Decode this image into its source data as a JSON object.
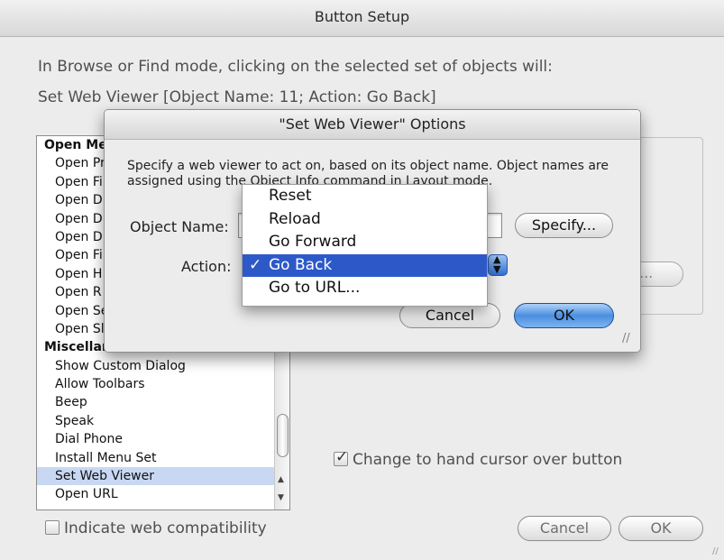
{
  "window": {
    "title": "Button Setup",
    "intro": "In Browse or Find mode, clicking on the selected set of objects will:",
    "step_description": "Set Web Viewer [Object Name: 11; Action: Go Back]"
  },
  "step_list": {
    "rows": [
      {
        "label": "Open Me",
        "category": true
      },
      {
        "label": "Open Pr"
      },
      {
        "label": "Open Fi"
      },
      {
        "label": "Open D"
      },
      {
        "label": "Open D"
      },
      {
        "label": "Open D"
      },
      {
        "label": "Open Fi"
      },
      {
        "label": "Open H"
      },
      {
        "label": "Open R"
      },
      {
        "label": "Open Se"
      },
      {
        "label": "Open Sl"
      },
      {
        "label": "Miscellaneous",
        "category": true
      },
      {
        "label": "Show Custom Dialog"
      },
      {
        "label": "Allow Toolbars"
      },
      {
        "label": "Beep"
      },
      {
        "label": "Speak"
      },
      {
        "label": "Dial Phone"
      },
      {
        "label": "Install Menu Set"
      },
      {
        "label": "Set Web Viewer",
        "selected": true
      },
      {
        "label": "Open URL"
      }
    ]
  },
  "options_partial_label": "...",
  "hand_cursor": {
    "label": "Change to hand cursor over button",
    "checked": true,
    "mark": "✓"
  },
  "web_compat": {
    "label": "Indicate web compatibility",
    "checked": false
  },
  "buttons": {
    "cancel": "Cancel",
    "ok": "OK"
  },
  "options_dialog": {
    "title": "\"Set Web Viewer\" Options",
    "description": "Specify a web viewer to act on, based on its object name. Object names are assigned using the Object Info command in Layout mode.",
    "object_name_label": "Object Name:",
    "object_name_value": "11",
    "specify_label": "Specify...",
    "action_label": "Action:",
    "cancel_label": "Cancel",
    "ok_label": "OK"
  },
  "action_menu": {
    "items": [
      "Reset",
      "Reload",
      "Go Forward",
      "Go Back",
      "Go to URL..."
    ],
    "selected_index": 3,
    "check": "✓"
  },
  "glyphs": {
    "up_arrow": "▲",
    "down_arrow": "▼",
    "stepper_up": "▲",
    "stepper_down": "▼",
    "grip": "//"
  },
  "colors": {
    "selection": "#2d59c8",
    "list_selection": "#c8d8f3",
    "default_button": "#4b8fe0"
  }
}
